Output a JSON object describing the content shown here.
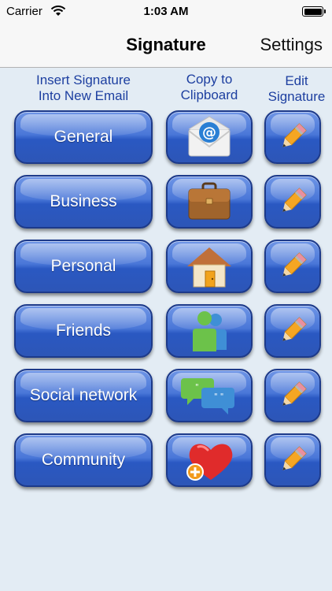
{
  "status_bar": {
    "carrier": "Carrier",
    "time": "1:03 AM"
  },
  "nav": {
    "title": "Signature",
    "settings_label": "Settings"
  },
  "headers": {
    "insert": {
      "line1": "Insert Signature",
      "line2": "Into New Email"
    },
    "copy": {
      "line1": "Copy to",
      "line2": "Clipboard"
    },
    "edit": {
      "line1": "Edit",
      "line2": "Signature"
    }
  },
  "rows": [
    {
      "label": "General",
      "copy_icon": "email-icon",
      "edit_icon": "pencil-icon"
    },
    {
      "label": "Business",
      "copy_icon": "briefcase-icon",
      "edit_icon": "pencil-icon"
    },
    {
      "label": "Personal",
      "copy_icon": "house-icon",
      "edit_icon": "pencil-icon"
    },
    {
      "label": "Friends",
      "copy_icon": "people-icon",
      "edit_icon": "pencil-icon"
    },
    {
      "label": "Social network",
      "copy_icon": "chat-bubbles-icon",
      "edit_icon": "pencil-icon"
    },
    {
      "label": "Community",
      "copy_icon": "heart-plus-icon",
      "edit_icon": "pencil-icon"
    }
  ],
  "colors": {
    "background": "#e3ecf4",
    "button_blue": "#2a58c2",
    "header_text": "#1d3fa0"
  }
}
